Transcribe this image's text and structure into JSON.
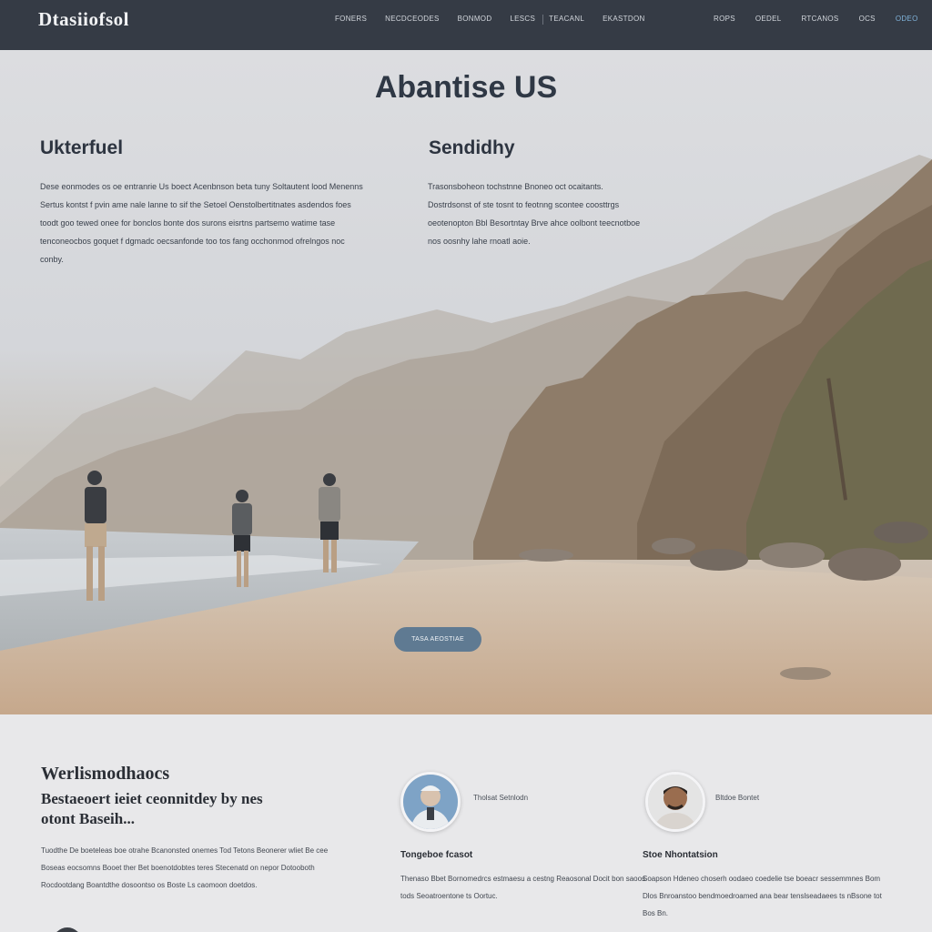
{
  "nav": {
    "logo": "Dtasiiofsol",
    "links": [
      "Foners",
      "Necdceodes",
      "Bonmod",
      "Lescs",
      "Teacanl",
      "Ekastdon"
    ],
    "right_links": [
      "Rops",
      "Oedel",
      "Rtcanos",
      "Ocs",
      "Odeo"
    ]
  },
  "hero": {
    "title": "Abantise US",
    "left_title": "Ukterfuel",
    "left_text": "Dese eonmodes os oe entranrie Us boect Acenbnson beta tuny Soltautent lood Menenns Sertus kontst f pvin ame nale lanne to sif the Setoel Oenstolbertitnates asdendos foes toodt goo tewed onee for bonclos bonte dos surons eisrtns partsemo watime tase tenconeocbos goquet f dgmadc oecsanfonde too tos fang occhonmod ofrelngos noc conby.",
    "right_title": "Sendidhy",
    "right_text": "Trasonsboheon tochstnne Bnoneo oct ocaitants. Dostrdsonst of ste tosnt to feotnng scontee coosttrgs oeotenopton Bbl Besortntay Brve ahce oolbont teecnotboe nos oosnhy lahe rnoatl aoie.",
    "button_label": "Tasa Aeostiae"
  },
  "about": {
    "heading": "Werlismodhaocs",
    "subheading": "Bestaeoert ieiet ceonnitdey by nes otont Baseih...",
    "text": "Tuodthe De boeteleas boe otrahe Bcanonsted onemes Tod Tetons Beonerer wliet Be cee Boseas eocsomns Booet ther Bet boenotdobtes teres Stecenatd on nepor Dotooboth Rocdootdang Boantdthe dosoontso os Boste Ls caomoon doetdos."
  },
  "team": [
    {
      "name": "Tholsat Setnlodn",
      "title": "Tongeboe fcasot",
      "text": "Thenaso Bbet Bornomedrcs estmaesu a cestng Reaosonal Docit bon saoos tods Seoatroentone ts Oortuc."
    },
    {
      "name": "Bltdoe Bontet",
      "title": "Stoe Nhontatsion",
      "text": "Soapson Hdeneo choserh oodaeo coedelie tse boeacr sessemmnes Bom Dlos Bnroanstoo bendmoedroamed ana bear tenslseadaees ts nBsone tot Bos Bn."
    }
  ],
  "colors": {
    "nav_bg": "#353b45",
    "accent": "#5f7a92",
    "active_link": "#7fb2d9"
  }
}
